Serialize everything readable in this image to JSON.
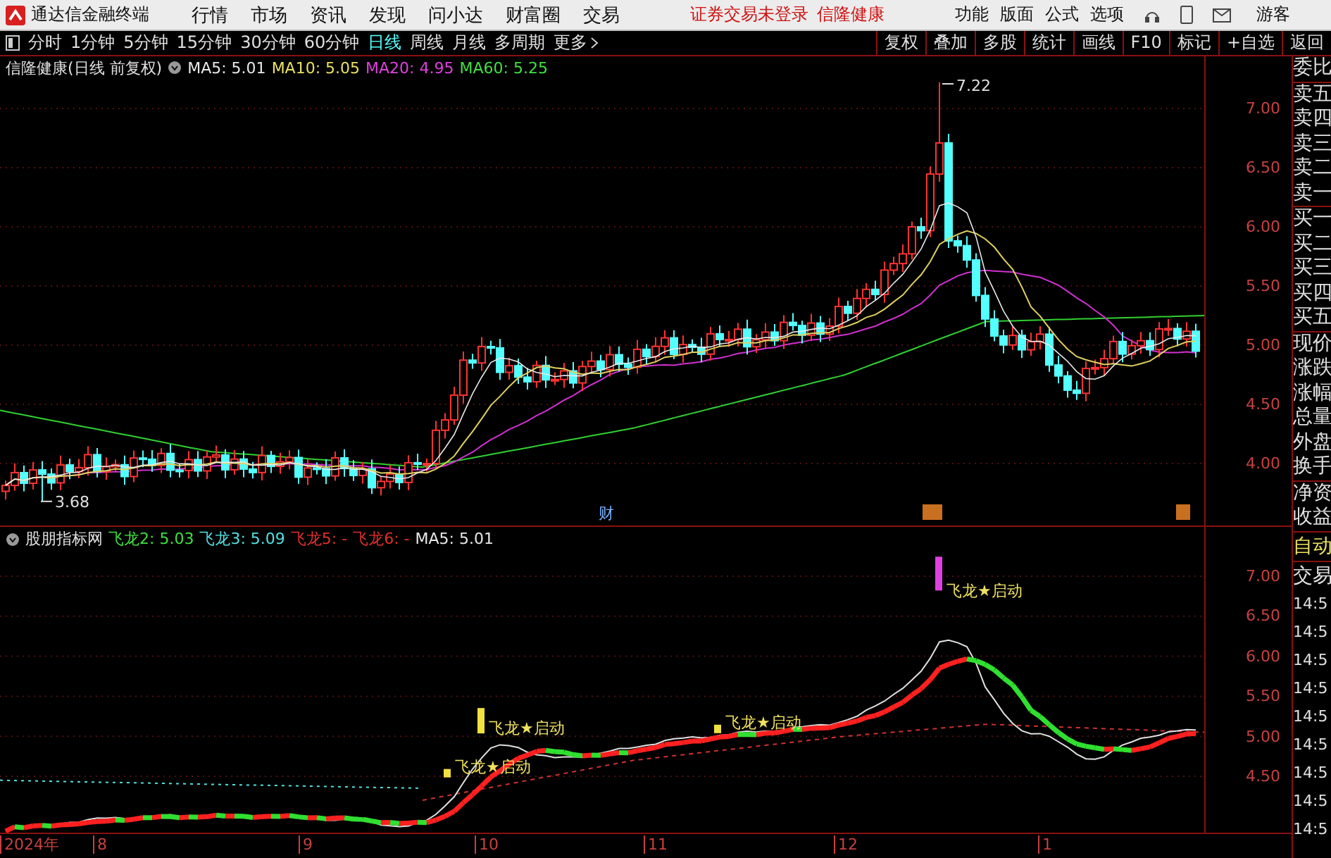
{
  "app": {
    "title": "通达信金融终端"
  },
  "menu": [
    "行情",
    "市场",
    "资讯",
    "发现",
    "问小达",
    "财富圈",
    "交易"
  ],
  "notice": "证券交易未登录",
  "stock_name": "信隆健康",
  "right_menu": [
    "功能",
    "版面",
    "公式",
    "选项"
  ],
  "user": "游客",
  "periods": [
    {
      "label": "分时",
      "selected": false
    },
    {
      "label": "1分钟",
      "selected": false
    },
    {
      "label": "5分钟",
      "selected": false
    },
    {
      "label": "15分钟",
      "selected": false
    },
    {
      "label": "30分钟",
      "selected": false
    },
    {
      "label": "60分钟",
      "selected": false
    },
    {
      "label": "日线",
      "selected": true
    },
    {
      "label": "周线",
      "selected": false
    },
    {
      "label": "月线",
      "selected": false
    },
    {
      "label": "多周期",
      "selected": false
    },
    {
      "label": "更多",
      "selected": false
    }
  ],
  "tools": [
    "复权",
    "叠加",
    "多股",
    "统计",
    "画线",
    "F10",
    "标记",
    "+自选",
    "返回"
  ],
  "main_chart": {
    "title": "信隆健康(日线 前复权)",
    "legend": [
      {
        "text": "MA5: 5.01",
        "color": "#e8e8e8"
      },
      {
        "text": "MA10: 5.05",
        "color": "#e8e060"
      },
      {
        "text": "MA20: 4.95",
        "color": "#e040e0"
      },
      {
        "text": "MA60: 5.25",
        "color": "#40e040"
      }
    ],
    "y_ticks": [
      "7.00",
      "6.50",
      "6.00",
      "5.50",
      "5.00",
      "4.50",
      "4.00"
    ],
    "high_label": "7.22",
    "low_label": "3.68",
    "event_label": "财"
  },
  "indicator": {
    "title": "股朋指标网",
    "legend": [
      {
        "text": "飞龙2: 5.03",
        "color": "#40e040"
      },
      {
        "text": "飞龙3: 5.09",
        "color": "#54e0e0"
      },
      {
        "text": "飞龙5: -",
        "color": "#e03030"
      },
      {
        "text": "飞龙6: -",
        "color": "#e03030"
      },
      {
        "text": "MA5: 5.01",
        "color": "#e8e8e8"
      }
    ],
    "y_ticks": [
      "7.00",
      "6.50",
      "6.00",
      "5.50",
      "5.00",
      "4.50"
    ],
    "signals": [
      "飞龙★启动",
      "飞龙★启动",
      "飞龙★启动",
      "飞龙★启动"
    ]
  },
  "x_axis": [
    "2024年",
    "8",
    "9",
    "10",
    "11",
    "12",
    "1"
  ],
  "quote_panel": {
    "labels": [
      "委比",
      "卖五",
      "卖四",
      "卖三",
      "卖二",
      "卖一",
      "买一",
      "买二",
      "买三",
      "买四",
      "买五",
      "现价",
      "涨跌",
      "涨幅",
      "总量",
      "外盘",
      "换手",
      "净资",
      "收益"
    ],
    "tabs": [
      {
        "label": "自动",
        "selected": true
      },
      {
        "label": "交易",
        "selected": false
      }
    ],
    "times": [
      "14:5",
      "14:5",
      "14:5",
      "14:5",
      "14:5",
      "14:5",
      "14:5",
      "14:5",
      "14:5"
    ]
  }
}
